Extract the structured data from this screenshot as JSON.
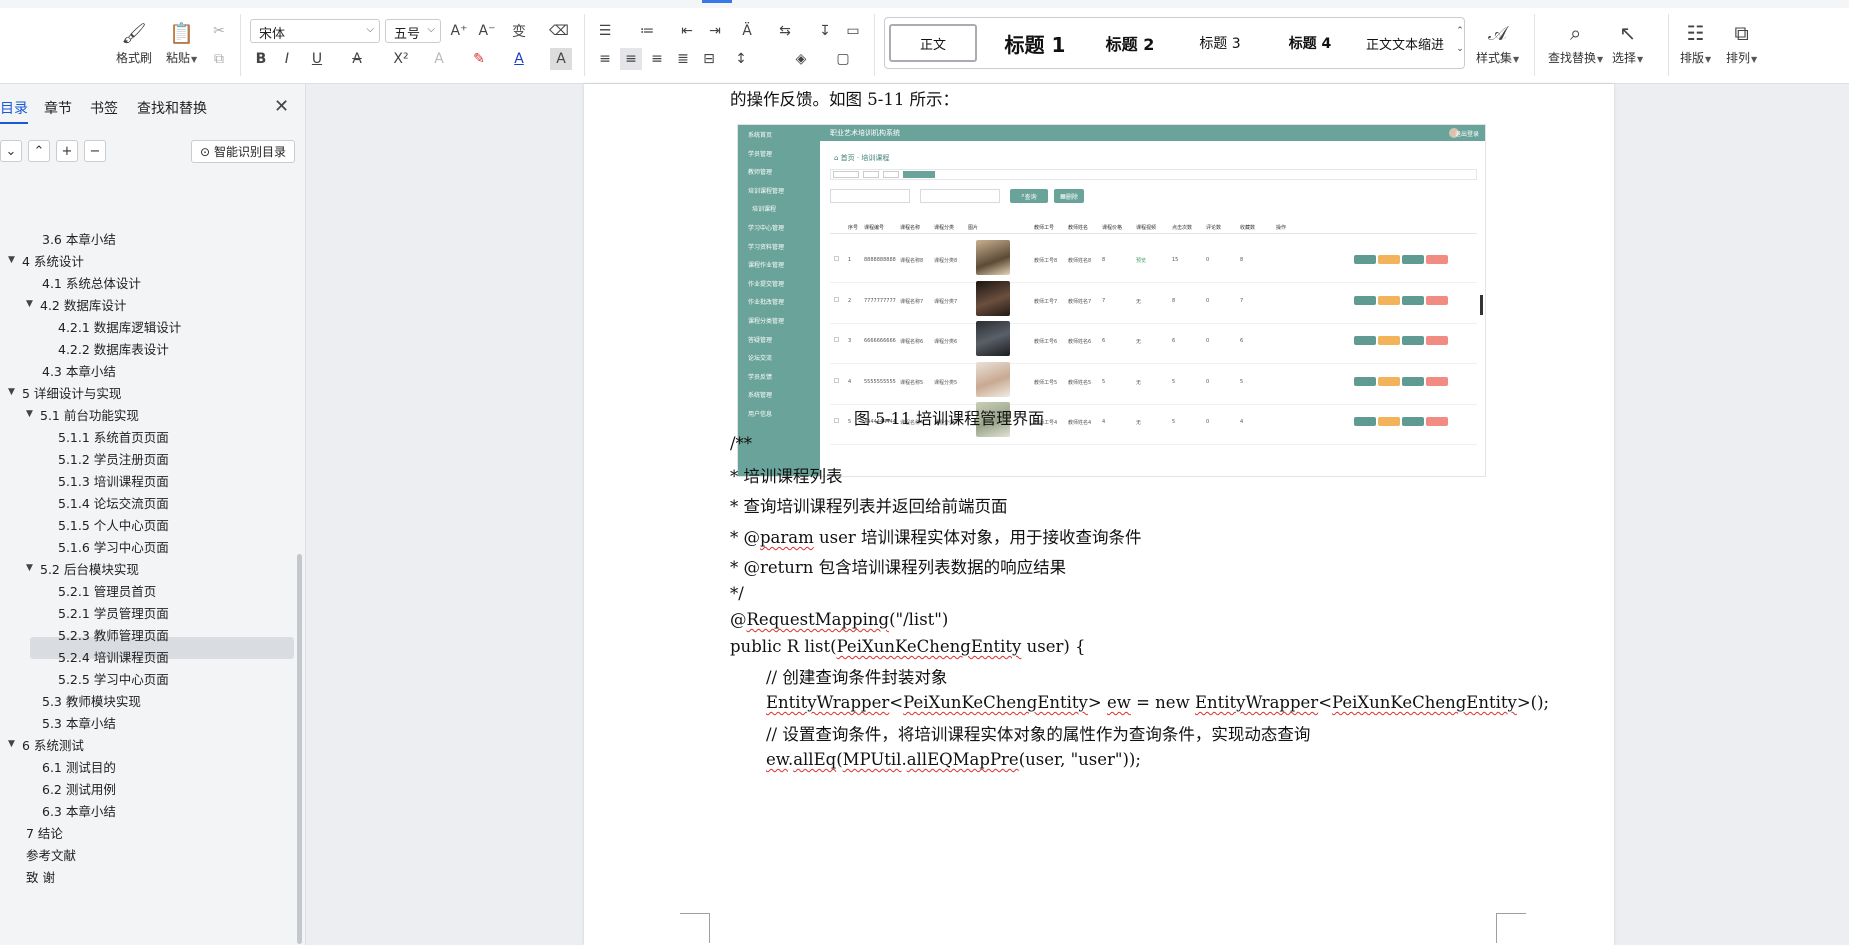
{
  "ribbon": {
    "format_painter": "格式刷",
    "paste": "粘贴",
    "font_name": "宋体",
    "font_size": "五号",
    "styles": [
      "正文",
      "标题 1",
      "标题 2",
      "标题 3",
      "标题 4",
      "正文文本缩进"
    ],
    "style_set": "样式集",
    "find_replace": "查找替换",
    "select": "选择",
    "layout": "排版",
    "arrange": "排列",
    "accent_color": "#1a58d6"
  },
  "sidebar": {
    "tabs": [
      "目录",
      "章节",
      "书签",
      "查找和替换"
    ],
    "smart_toc": "智能识别目录",
    "items": [
      {
        "label": "3.6 本章小结",
        "level": 2
      },
      {
        "label": "4 系统设计",
        "level": 1,
        "expanded": true
      },
      {
        "label": "4.1 系统总体设计",
        "level": 2
      },
      {
        "label": "4.2 数据库设计",
        "level": 2,
        "expanded": true
      },
      {
        "label": "4.2.1 数据库逻辑设计",
        "level": 3
      },
      {
        "label": "4.2.2 数据库表设计",
        "level": 3
      },
      {
        "label": "4.3 本章小结",
        "level": 2
      },
      {
        "label": "5 详细设计与实现",
        "level": 1,
        "expanded": true
      },
      {
        "label": "5.1 前台功能实现",
        "level": 2,
        "expanded": true
      },
      {
        "label": "5.1.1 系统首页页面",
        "level": 3
      },
      {
        "label": "5.1.2 学员注册页面",
        "level": 3
      },
      {
        "label": "5.1.3 培训课程页面",
        "level": 3
      },
      {
        "label": "5.1.4 论坛交流页面",
        "level": 3
      },
      {
        "label": "5.1.5 个人中心页面",
        "level": 3
      },
      {
        "label": "5.1.6 学习中心页面",
        "level": 3
      },
      {
        "label": "5.2 后台模块实现",
        "level": 2,
        "expanded": true
      },
      {
        "label": "5.2.1 管理员首页",
        "level": 3
      },
      {
        "label": "5.2.1 学员管理页面",
        "level": 3
      },
      {
        "label": "5.2.3 教师管理页面",
        "level": 3,
        "selected": true
      },
      {
        "label": "5.2.4 培训课程页面",
        "level": 3
      },
      {
        "label": "5.2.5 学习中心页面",
        "level": 3
      },
      {
        "label": "5.3 教师模块实现",
        "level": 2
      },
      {
        "label": "5.3 本章小结",
        "level": 2
      },
      {
        "label": "6 系统测试",
        "level": 1,
        "expanded": true
      },
      {
        "label": "6.1 测试目的",
        "level": 2
      },
      {
        "label": "6.2 测试用例",
        "level": 2
      },
      {
        "label": "6.3 本章小结",
        "level": 2
      },
      {
        "label": "7 结论",
        "level": 1
      },
      {
        "label": "参考文献",
        "level": 1
      },
      {
        "label": "致   谢",
        "level": 1
      }
    ]
  },
  "document": {
    "intro": "的操作反馈。如图 5-11 所示：",
    "caption": "图 5-11 培训课程管理界面",
    "code_lines": [
      "/**",
      " *  培训课程列表",
      " *  查询培训课程列表并返回给前端页面",
      " * @param user  培训课程实体对象，用于接收查询条件",
      " * @return  包含培训课程列表数据的响应结果",
      " */",
      "@RequestMapping(\"/list\")",
      "public R list(PeiXunKeChengEntity user) {",
      "//  创建查询条件封装对象",
      "EntityWrapper<PeiXunKeChengEntity> ew = new EntityWrapper<PeiXunKeChengEntity>();",
      "//  设置查询条件，将培训课程实体对象的属性作为查询条件，实现动态查询",
      "ew.allEq(MPUtil.allEQMapPre(user, \"user\"));"
    ]
  },
  "screenshot": {
    "app_title": "职业艺术培训机构系统",
    "logout": "退出登录",
    "breadcrumb": "首页 · 培训课程",
    "search_btn": "查询",
    "delete_btn": "删除",
    "menu": [
      "系统首页",
      "学员管理",
      "教师管理",
      "培训课程管理",
      "培训课程",
      "学习中心管理",
      "学习资料管理",
      "课程作业管理",
      "作业提交管理",
      "作业批改管理",
      "课程分类管理",
      "答疑管理",
      "论坛交流",
      "学员反馈",
      "系统管理",
      "用户信息"
    ],
    "headers": [
      "序号",
      "课程编号",
      "课程名称",
      "课程分类",
      "图片",
      "教师工号",
      "教师姓名",
      "课程价格",
      "课程视频",
      "点击次数",
      "评论数",
      "收藏数",
      "操作"
    ],
    "rows": [
      {
        "no": "1",
        "code": "8888888888",
        "name": "课程名称8",
        "cat": "课程分类8",
        "tno": "教师工号8",
        "tname": "教师姓名8",
        "price": "8",
        "video": "预览",
        "clicks": "15",
        "comments": "0",
        "favs": "8"
      },
      {
        "no": "2",
        "code": "7777777777",
        "name": "课程名称7",
        "cat": "课程分类7",
        "tno": "教师工号7",
        "tname": "教师姓名7",
        "price": "7",
        "video": "无",
        "clicks": "8",
        "comments": "0",
        "favs": "7"
      },
      {
        "no": "3",
        "code": "6666666666",
        "name": "课程名称6",
        "cat": "课程分类6",
        "tno": "教师工号6",
        "tname": "教师姓名6",
        "price": "6",
        "video": "无",
        "clicks": "6",
        "comments": "0",
        "favs": "6"
      },
      {
        "no": "4",
        "code": "5555555555",
        "name": "课程名称5",
        "cat": "课程分类5",
        "tno": "教师工号5",
        "tname": "教师姓名5",
        "price": "5",
        "video": "无",
        "clicks": "5",
        "comments": "0",
        "favs": "5"
      },
      {
        "no": "5",
        "code": "4444444444",
        "name": "课程名称4",
        "cat": "课程分类4",
        "tno": "教师工号4",
        "tname": "教师姓名4",
        "price": "4",
        "video": "无",
        "clicks": "5",
        "comments": "0",
        "favs": "4"
      }
    ]
  }
}
